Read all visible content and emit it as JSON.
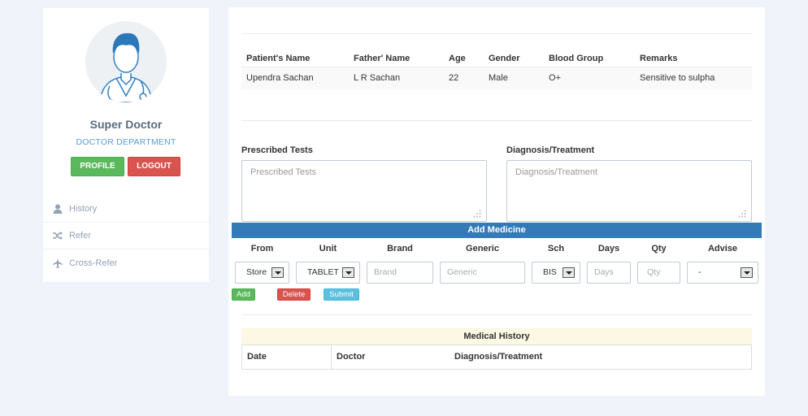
{
  "profile": {
    "name": "Super Doctor",
    "department": "DOCTOR DEPARTMENT",
    "profile_button": "PROFILE",
    "logout_button": "LOGOUT"
  },
  "sidebar": {
    "items": [
      {
        "label": "History",
        "icon": "user-icon"
      },
      {
        "label": "Refer",
        "icon": "shuffle-icon"
      },
      {
        "label": "Cross-Refer",
        "icon": "plane-icon"
      }
    ]
  },
  "patient_table": {
    "headers": [
      "Patient's Name",
      "Father' Name",
      "Age",
      "Gender",
      "Blood Group",
      "Remarks"
    ],
    "row": [
      "Upendra Sachan",
      "L R Sachan",
      "22",
      "Male",
      "O+",
      "Sensitive to sulpha"
    ]
  },
  "prescribed_tests": {
    "label": "Prescribed Tests",
    "placeholder": "Prescribed Tests"
  },
  "diagnosis": {
    "label": "Diagnosis/Treatment",
    "placeholder": "Diagnosis/Treatment"
  },
  "add_medicine": {
    "title": "Add Medicine",
    "headers": [
      "From",
      "Unit",
      "Brand",
      "Generic",
      "Sch",
      "Days",
      "Qty",
      "Advise"
    ],
    "from_value": "Store",
    "unit_value": "TABLET",
    "brand_placeholder": "Brand",
    "generic_placeholder": "Generic",
    "sch_value": "BIS",
    "days_placeholder": "Days",
    "qty_placeholder": "Qty",
    "advise_value": "-",
    "add_button": "Add",
    "delete_button": "Delete",
    "submit_button": "Submit"
  },
  "medical_history": {
    "title": "Medical History",
    "headers": [
      "Date",
      "Doctor",
      "Diagnosis/Treatment"
    ]
  },
  "colors": {
    "background": "#f1f3fa",
    "primary_bar": "#337ab7",
    "success": "#5cb85c",
    "danger": "#d9534f",
    "info": "#5bc0de",
    "history_header": "#fcf8e3"
  }
}
